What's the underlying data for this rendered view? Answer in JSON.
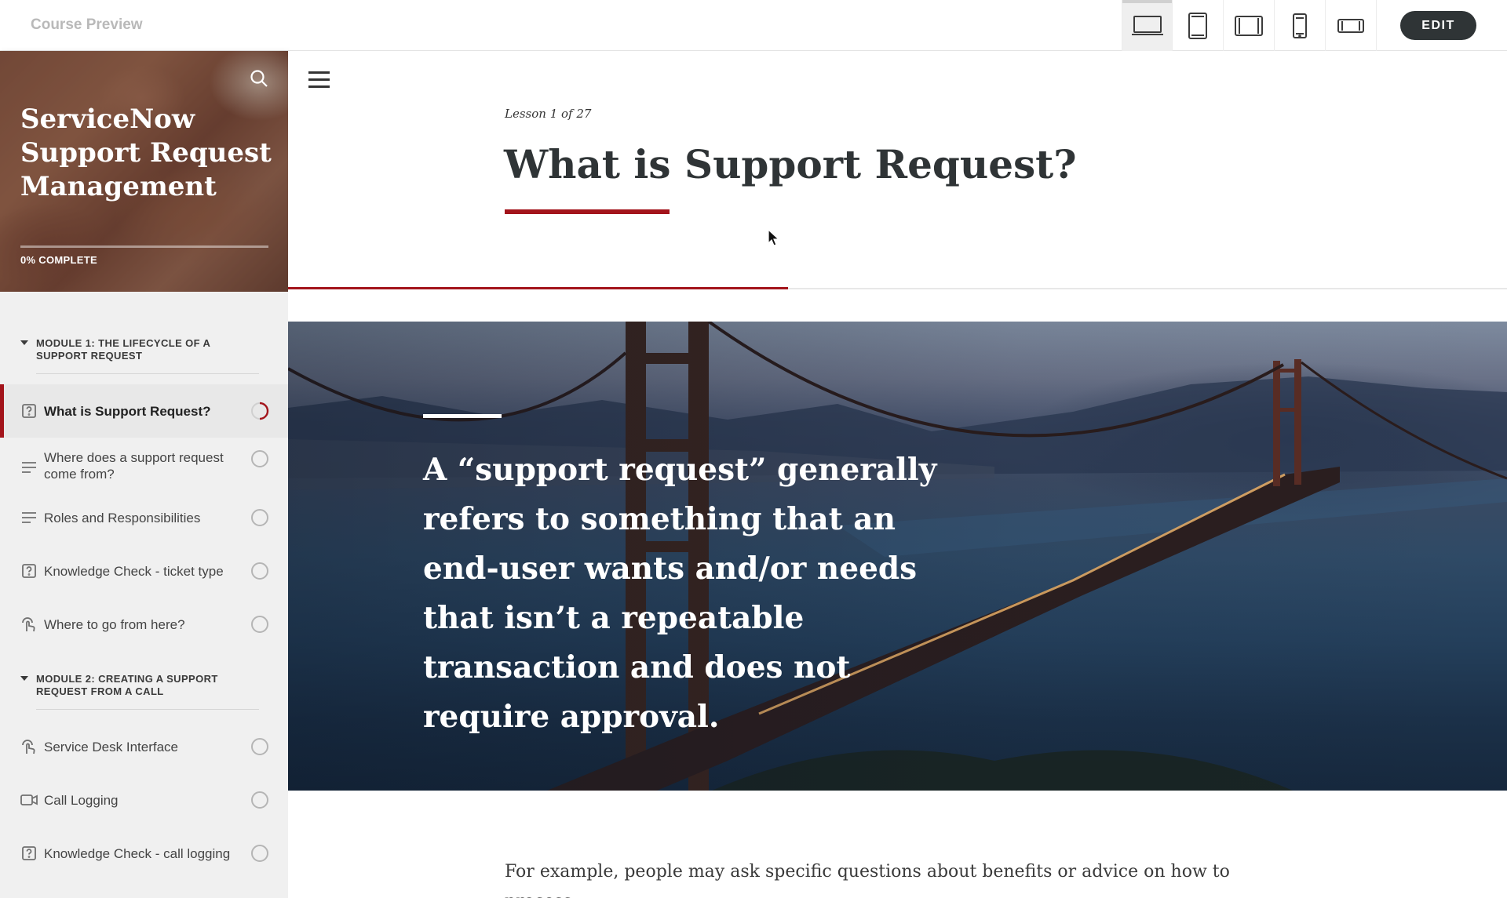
{
  "header": {
    "app_title": "Course Preview",
    "edit_label": "EDIT",
    "devices": [
      {
        "icon": "laptop-icon",
        "active": true
      },
      {
        "icon": "tablet-icon",
        "active": false
      },
      {
        "icon": "tablet-landscape-icon",
        "active": false
      },
      {
        "icon": "phone-icon",
        "active": false
      },
      {
        "icon": "phone-landscape-icon",
        "active": false
      }
    ]
  },
  "sidebar": {
    "course_title": "ServiceNow Support Request Management",
    "progress_label": "0% COMPLETE",
    "progress_fraction": 0,
    "modules": [
      {
        "title": "MODULE 1: THE LIFECYCLE OF A SUPPORT REQUEST",
        "lessons": [
          {
            "title": "What is Support Request?",
            "icon": "quiz-icon",
            "status": "in-progress",
            "active": true
          },
          {
            "title": "Where does a support request come from?",
            "icon": "text-lesson-icon",
            "status": "not-started"
          },
          {
            "title": "Roles and Responsibilities",
            "icon": "text-lesson-icon",
            "status": "not-started"
          },
          {
            "title": "Knowledge Check - ticket type",
            "icon": "quiz-icon",
            "status": "not-started"
          },
          {
            "title": "Where to go from here?",
            "icon": "interactive-lesson-icon",
            "status": "not-started"
          }
        ]
      },
      {
        "title": "MODULE 2: CREATING A SUPPORT REQUEST FROM A CALL",
        "lessons": [
          {
            "title": "Service Desk Interface",
            "icon": "interactive-lesson-icon",
            "status": "not-started"
          },
          {
            "title": "Call Logging",
            "icon": "video-icon",
            "status": "not-started"
          },
          {
            "title": "Knowledge Check - call logging",
            "icon": "quiz-icon",
            "status": "not-started"
          }
        ]
      }
    ]
  },
  "lesson": {
    "counter": "Lesson 1 of 27",
    "title": "What is Support Request?",
    "scroll_progress_fraction": 0.41,
    "quote": "A “support request” generally refers to something that an end-user wants and/or needs that isn’t a repeatable transaction and does not require approval.",
    "body": "For example, people may ask specific questions about benefits or advice on how to process"
  },
  "colors": {
    "accent": "#a3141b",
    "edit_button": "#2f3436",
    "heading": "#2f3436"
  }
}
